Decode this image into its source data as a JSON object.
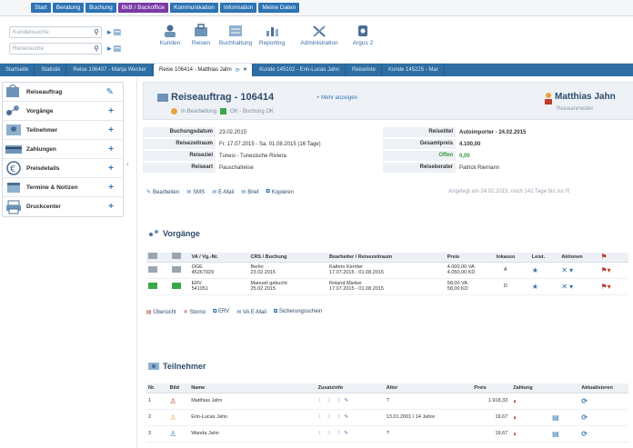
{
  "topmenu": [
    "Start",
    "Beratung",
    "Buchung",
    "BkB / Backoffice",
    "Kommunikation",
    "Information",
    "Meine Daten"
  ],
  "search": {
    "customer_placeholder": "Kundensuche",
    "trip_placeholder": "Reisesuche"
  },
  "toolbar": {
    "kunden": "Kunden",
    "reisen": "Reisen",
    "buchhaltung": "Buchhaltung",
    "reporting": "Reporting",
    "administration": "Administration",
    "argus": "Argus 2"
  },
  "tabs": [
    "Startseite",
    "Statistik",
    "Reise 106407 - Manja Wecker",
    "Reise 106414 - Matthias Jahn",
    "Kunde 145102 - Erin-Lucas Jahn",
    "Reiseliste",
    "Kunde 145225 - Mar"
  ],
  "sidebar": [
    "Reiseauftrag",
    "Vorgänge",
    "Teilnehmer",
    "Zahlungen",
    "Preisdetails",
    "Termine & Notizen",
    "Druckcenter"
  ],
  "header": {
    "title": "Reiseauftrag - 106414",
    "more_info": "Mehr anzeigen",
    "status1": "In Bearbeitung",
    "status2": "OK - Buchung OK",
    "person": "Matthias Jahn",
    "person_role": "Reiseanmelder"
  },
  "info": {
    "left": [
      {
        "label": "Buchungsdatum",
        "value": "23.02.2015"
      },
      {
        "label": "Reisezeitraum",
        "value": "Fr. 17.07.2015 - Sa. 01.08.2015 (16 Tage)"
      },
      {
        "label": "Reiseziel",
        "value": "Tunesi - Tunesische Riviera"
      },
      {
        "label": "Reiseart",
        "value": "Pauschalreise"
      }
    ],
    "right": [
      {
        "label": "Reisetitel",
        "value": "Autoimporter - 24.02.2015"
      },
      {
        "label": "Gesamtpreis",
        "value": "4.100,00"
      },
      {
        "label": "Offen",
        "value": "0,00"
      },
      {
        "label": "Reiseberater",
        "value": "Patrick Riemann"
      }
    ]
  },
  "actions": [
    "Bearbeiten",
    "SMS",
    "E-Mail",
    "Brief",
    "Kopieren"
  ],
  "created": "Angelegt am 24.02.2015, noch 142 Tage bis zur R",
  "vorgaenge": {
    "title": "Vorgänge",
    "headers": [
      "",
      "",
      "VA / Vg.-Nr.",
      "CRS / Buchung",
      "Bearbeiter / Reisezeitraum",
      "Preis",
      "Inkasso",
      "Leist.",
      "Aktionen",
      ""
    ],
    "rows": [
      {
        "va1": "OGE",
        "va2": "45267929",
        "crs1": "Berlin",
        "crs2": "23.02.2015",
        "bz1": "Kathrin Kernter",
        "bz2": "17.07.2015 - 01.08.2015",
        "p1": "4.000,00 VA",
        "p2": "4.050,00 KD",
        "ink": "A",
        "green": false
      },
      {
        "va1": "ERV",
        "va2": "541051",
        "crs1": "Manuell gebucht",
        "crs2": "25.02.2015",
        "bz1": "Roland Marker",
        "bz2": "17.07.2015 - 01.08.2015",
        "p1": "58,00 VA",
        "p2": "58,00 KD",
        "ink": "D",
        "green": true
      }
    ]
  },
  "vg_footer": [
    "Übersicht",
    "Storno",
    "ERV",
    "VA E-Mail",
    "Sicherungsschein"
  ],
  "teilnehmer": {
    "title": "Teilnehmer",
    "headers": [
      "Nr.",
      "Bild",
      "Name",
      "Zusatzinfo",
      "Alter",
      "Preis",
      "Zahlung",
      "",
      "Aktualisieren"
    ],
    "rows": [
      {
        "nr": "1",
        "name": "Matthias Jahn",
        "zusatz": "1 2 3",
        "alter": "?",
        "preis": "1.918,33"
      },
      {
        "nr": "2",
        "name": "Erin-Lucas Jahn",
        "zusatz": "1 2 3",
        "alter": "13.01.2001 / 14 Jahre",
        "preis": "19,67"
      },
      {
        "nr": "3",
        "name": "Wanda Jahn",
        "zusatz": "1 2 3",
        "alter": "?",
        "preis": "19,67"
      }
    ]
  }
}
